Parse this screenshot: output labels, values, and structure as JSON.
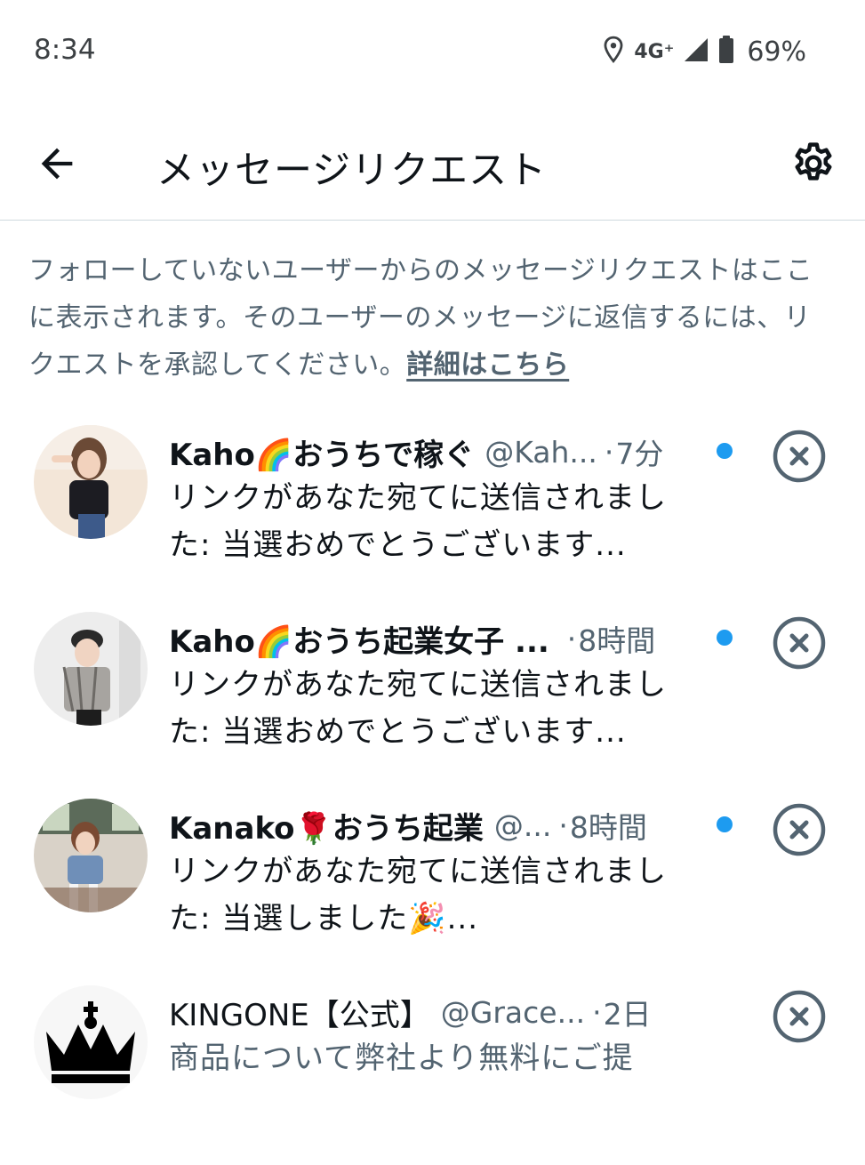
{
  "status_bar": {
    "time": "8:34",
    "network": "4G⁺",
    "battery": "69%",
    "icons": [
      "location-icon",
      "signal-icon",
      "battery-icon"
    ]
  },
  "app_bar": {
    "back_icon": "arrow-left-icon",
    "title": "メッセージリクエスト",
    "settings_icon": "gear-icon"
  },
  "info": {
    "text": "フォローしていないユーザーからのメッセージリクエストはここに表示されます。そのユーザーのメッセージに返信するには、リクエストを承認してください。",
    "link": "詳細はこちら"
  },
  "requests": [
    {
      "name": "Kaho🌈おうちで稼ぐ",
      "handle": "@Kah...",
      "sep": "·",
      "time": "7分",
      "unread": true,
      "preview": "リンクがあなた宛てに送信されました: 当選おめでとうございます..."
    },
    {
      "name": "Kaho🌈おうち起業女子 ...",
      "handle": "",
      "sep": "·",
      "time": "8時間",
      "unread": true,
      "preview": "リンクがあなた宛てに送信されました: 当選おめでとうございます..."
    },
    {
      "name": "Kanako🌹おうち起業",
      "handle": "@...",
      "sep": "·",
      "time": "8時間",
      "unread": true,
      "preview": "リンクがあなた宛てに送信されました: 当選しました🎉..."
    },
    {
      "name": "KINGONE【公式】",
      "handle": "@Grace...",
      "sep": "·",
      "time": "2日",
      "unread": false,
      "preview": "商品について弊社より無料にご提"
    }
  ],
  "colors": {
    "accent": "#1d9bf0",
    "secondary_text": "#536471",
    "primary_text": "#0f1419",
    "divider": "#cfd9de"
  }
}
